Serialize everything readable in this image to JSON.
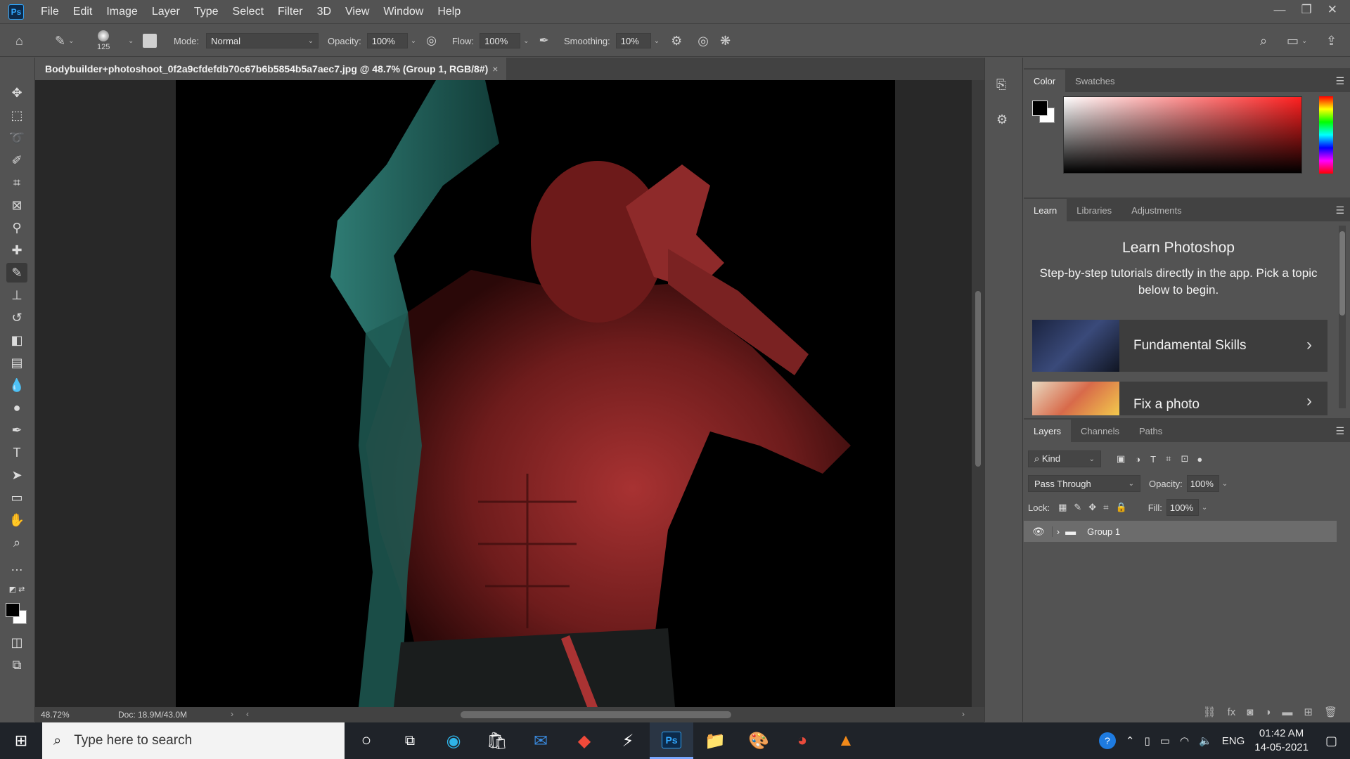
{
  "app": {
    "logo": "Ps"
  },
  "menu": [
    "File",
    "Edit",
    "Image",
    "Layer",
    "Type",
    "Select",
    "Filter",
    "3D",
    "View",
    "Window",
    "Help"
  ],
  "options": {
    "brush_size": "125",
    "mode_label": "Mode:",
    "mode_value": "Normal",
    "opacity_label": "Opacity:",
    "opacity_value": "100%",
    "flow_label": "Flow:",
    "flow_value": "100%",
    "smoothing_label": "Smoothing:",
    "smoothing_value": "10%"
  },
  "document": {
    "tab_title": "Bodybuilder+photoshoot_0f2a9cfdefdb70c67b6b5854b5a7aec7.jpg @ 48.7% (Group 1, RGB/8#)",
    "close": "×",
    "zoom": "48.72%",
    "doc_size": "Doc: 18.9M/43.0M"
  },
  "color_panel": {
    "tabs": [
      "Color",
      "Swatches"
    ],
    "fg": "#000000",
    "bg": "#ffffff"
  },
  "learn_panel": {
    "tabs": [
      "Learn",
      "Libraries",
      "Adjustments"
    ],
    "title": "Learn Photoshop",
    "subtitle": "Step-by-step tutorials directly in the app. Pick a topic below to begin.",
    "cards": [
      "Fundamental Skills",
      "Fix a photo"
    ]
  },
  "layers_panel": {
    "tabs": [
      "Layers",
      "Channels",
      "Paths"
    ],
    "filter_kind": "Kind",
    "blend_mode": "Pass Through",
    "opacity_label": "Opacity:",
    "opacity_value": "100%",
    "lock_label": "Lock:",
    "fill_label": "Fill:",
    "fill_value": "100%",
    "layers": [
      {
        "name": "Group 1",
        "visible": true,
        "type": "group"
      }
    ]
  },
  "taskbar": {
    "search_placeholder": "Type here to search",
    "language": "ENG",
    "time": "01:42 AM",
    "date": "14-05-2021"
  }
}
